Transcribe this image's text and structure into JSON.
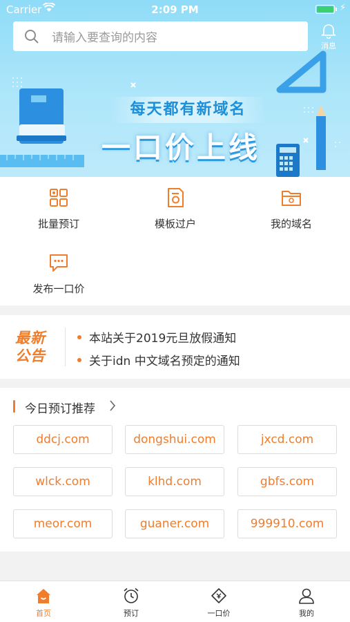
{
  "status_bar": {
    "carrier": "Carrier",
    "time": "2:09 PM"
  },
  "search": {
    "placeholder": "请输入要查询的内容"
  },
  "header": {
    "message_label": "消息"
  },
  "banner": {
    "line1": "每天都有新域名",
    "line2": "一口价上线"
  },
  "quick_actions": [
    {
      "label": "批量预订",
      "icon": "batch-grid-icon"
    },
    {
      "label": "模板过户",
      "icon": "template-doc-icon"
    },
    {
      "label": "我的域名",
      "icon": "folder-icon"
    },
    {
      "label": "发布一口价",
      "icon": "publish-chat-icon"
    }
  ],
  "notice": {
    "logo_line1": "最新",
    "logo_line2": "公告",
    "items": [
      "本站关于2019元旦放假通知",
      "关于idn 中文域名预定的通知"
    ]
  },
  "recommend": {
    "title": "今日预订推荐",
    "domains": [
      "ddcj.com",
      "dongshui.com",
      "jxcd.com",
      "wlck.com",
      "klhd.com",
      "gbfs.com",
      "meor.com",
      "guaner.com",
      "999910.com"
    ]
  },
  "tabbar": {
    "items": [
      {
        "label": "首页",
        "icon": "home-icon",
        "active": true
      },
      {
        "label": "预订",
        "icon": "alarm-clock-icon",
        "active": false
      },
      {
        "label": "一口价",
        "icon": "price-tag-icon",
        "active": false
      },
      {
        "label": "我的",
        "icon": "user-icon",
        "active": false
      }
    ]
  },
  "colors": {
    "accent": "#f07d2c",
    "banner_blue": "#8fdcf8",
    "title_blue": "#1d8fd8"
  }
}
